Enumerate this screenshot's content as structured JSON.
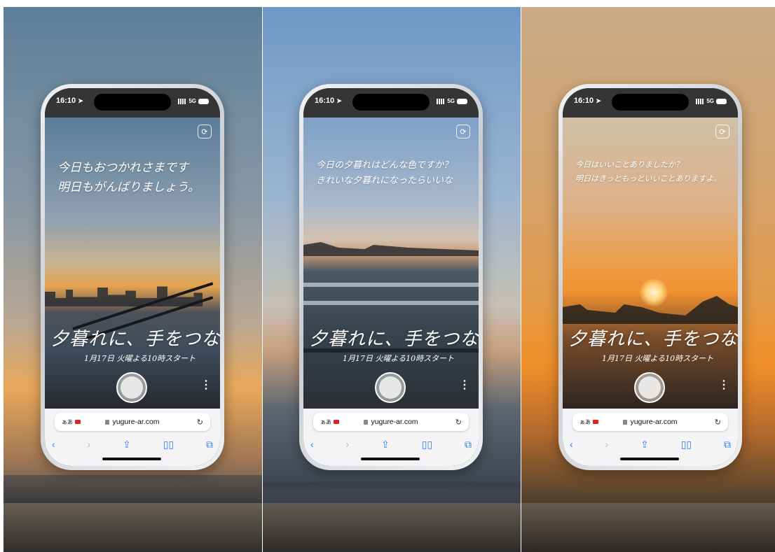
{
  "status_bar": {
    "time": "16:10",
    "network": "5G"
  },
  "browser": {
    "aa_label": "ぁあ",
    "url": "yugure-ar.com",
    "icons": [
      "back-icon",
      "forward-icon",
      "share-icon",
      "bookmarks-icon",
      "tabs-icon"
    ]
  },
  "tagline": "夕暮れに、手をつなぐ",
  "date": "1月17日 火曜よる10時スタート",
  "panels": [
    {
      "message_lines": [
        "今日もおつかれさまです",
        "明日もがんばりましょう。"
      ]
    },
    {
      "message_lines": [
        "今日の夕暮れはどんな色ですか？",
        "きれいな夕暮れになったらいいな"
      ]
    },
    {
      "message_lines": [
        "今日はいいことありましたか？",
        "明日はきっともっといいことありますよ。"
      ]
    }
  ],
  "colors": {
    "browser_accent": "#2a7ef2",
    "record_indicator": "#e02424"
  }
}
